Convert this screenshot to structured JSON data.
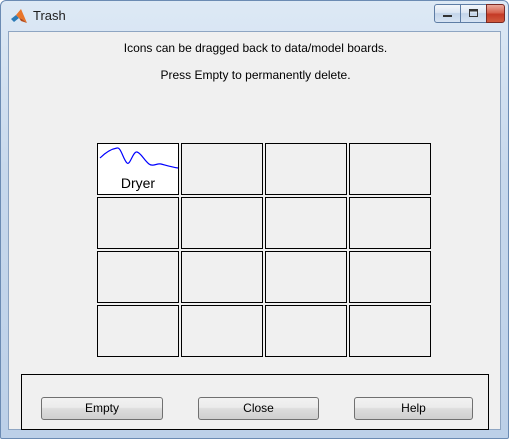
{
  "window": {
    "title": "Trash"
  },
  "messages": {
    "line1": "Icons can be dragged back to data/model boards.",
    "line2": "Press Empty to permanently delete."
  },
  "grid": {
    "rows": 4,
    "cols": 4,
    "items": [
      {
        "row": 0,
        "col": 0,
        "label": "Dryer",
        "thumbnail": "waveform-icon",
        "thumbnail_color": "#0000ff"
      }
    ]
  },
  "buttons": {
    "empty": "Empty",
    "close": "Close",
    "help": "Help"
  },
  "colors": {
    "close_button": "#c9453a",
    "waveform": "#0000ff"
  }
}
